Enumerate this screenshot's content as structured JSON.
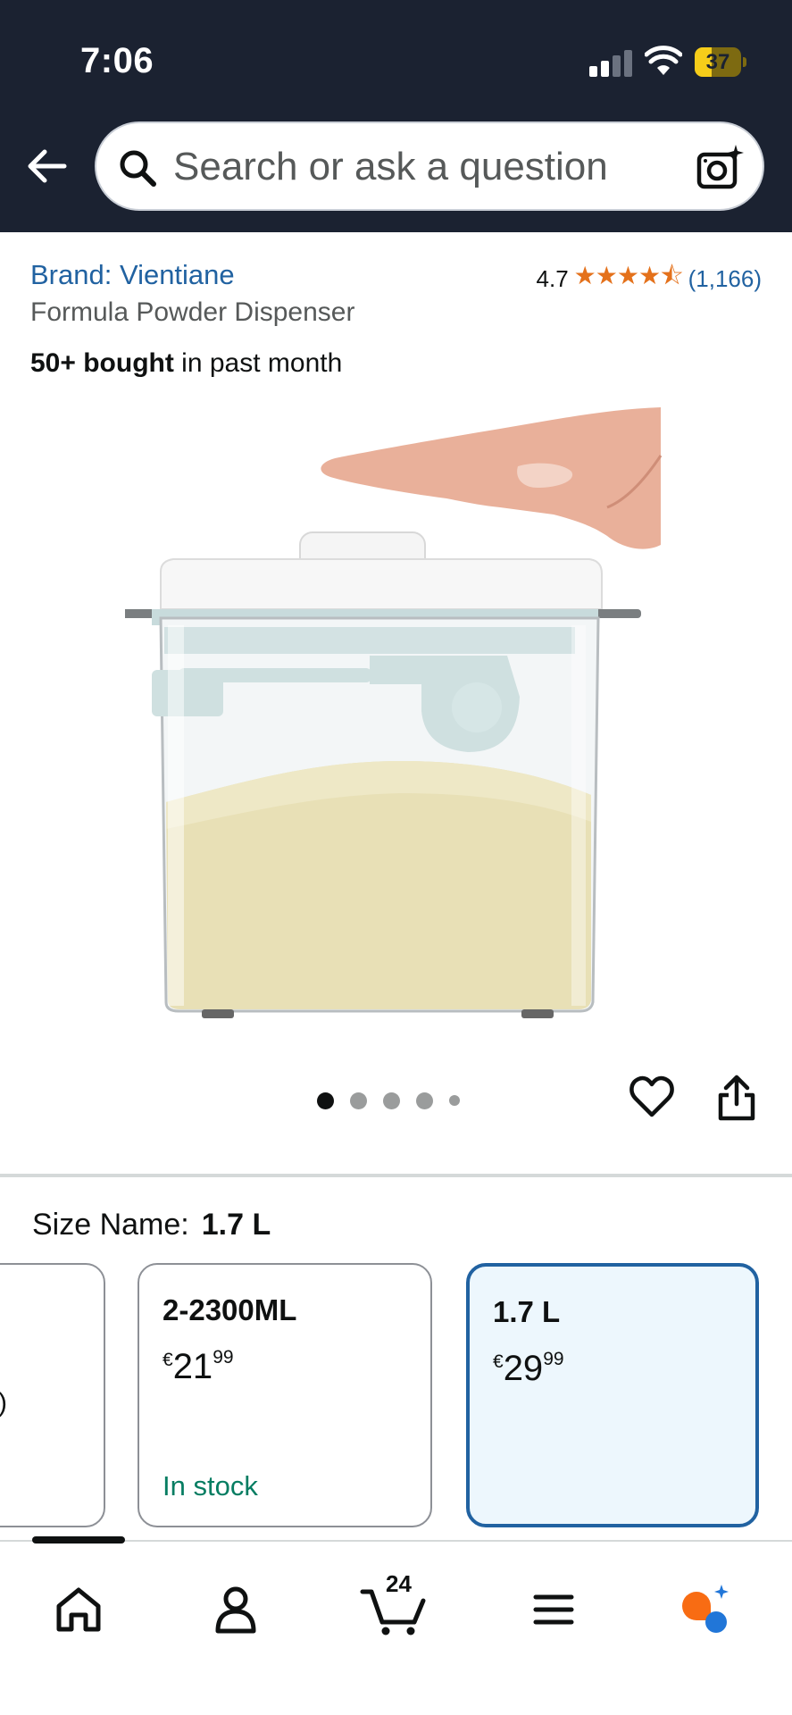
{
  "status_bar": {
    "time": "7:06",
    "battery": "37",
    "battery_level": 0.37
  },
  "header": {
    "back_icon": "arrow-left-icon",
    "search": {
      "placeholder": "Search or ask a question",
      "search_icon": "magnifier-icon",
      "camera_icon": "camera-sparkle-icon"
    }
  },
  "product": {
    "brand": "Brand: Vientiane",
    "rating_value": "4.7",
    "rating_stars": 4.7,
    "stars_glyphs": "★★★★⯪",
    "rating_count": "(1,166)",
    "subtitle": "Formula Powder Dispenser",
    "bought_bold": "50+ bought",
    "bought_rest": " in past month",
    "image_count": 5,
    "active_image": 1
  },
  "size": {
    "label": "Size Name:",
    "selected": "1.7 L",
    "options": [
      {
        "name": "",
        "edge_text": ")",
        "currency": "",
        "whole": "",
        "fraction": "",
        "stock": ""
      },
      {
        "name": "2-2300ML",
        "currency": "€",
        "whole": "21",
        "fraction": "99",
        "stock": "In stock"
      },
      {
        "name": "1.7 L",
        "currency": "€",
        "whole": "29",
        "fraction": "99",
        "stock": ""
      }
    ]
  },
  "bottom_nav": {
    "items": [
      "home-icon",
      "account-icon",
      "cart-icon",
      "menu-icon",
      "rufus-icon"
    ],
    "cart_count": "24"
  },
  "colors": {
    "header_bg": "#1b2231",
    "link": "#2162a1",
    "star": "#e4711b",
    "in_stock": "#067d62",
    "selected_border": "#2162a1",
    "selected_bg": "#edf7fd",
    "battery": "#f6cd1a"
  }
}
